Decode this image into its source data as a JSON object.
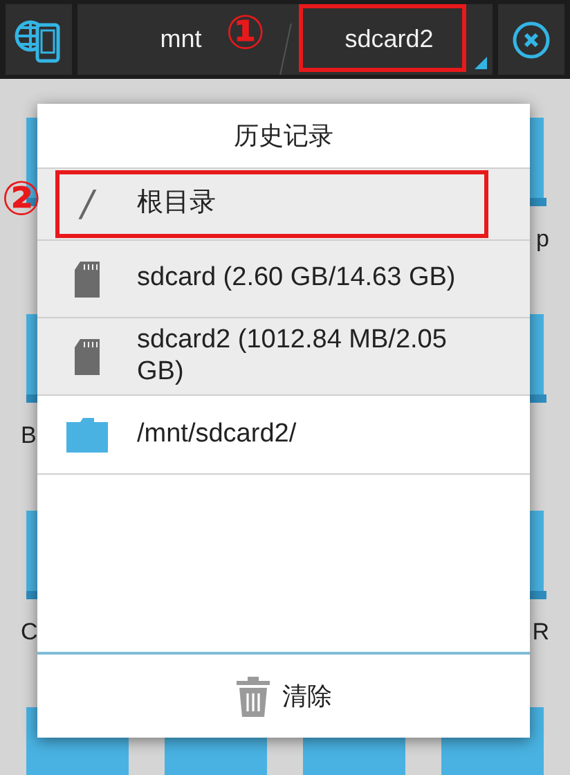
{
  "toolbar": {
    "breadcrumbs": [
      {
        "label": "mnt",
        "selected": false
      },
      {
        "label": "sdcard2",
        "selected": true
      }
    ]
  },
  "background": {
    "folder_rows": [
      {
        "right_label": "p"
      },
      {
        "left_label": "B"
      },
      {
        "left_label": "C",
        "right_label": "R"
      }
    ]
  },
  "history_dialog": {
    "title": "历史记录",
    "items": [
      {
        "kind": "root",
        "icon": "/",
        "label": "根目录"
      },
      {
        "kind": "storage",
        "label": "sdcard (2.60 GB/14.63 GB)"
      },
      {
        "kind": "storage",
        "label": "sdcard2 (1012.84 MB/2.05 GB)"
      },
      {
        "kind": "folder",
        "label": "/mnt/sdcard2/"
      }
    ],
    "clear_button": "清除"
  },
  "annotations": [
    {
      "number": "①"
    },
    {
      "number": "②"
    }
  ]
}
